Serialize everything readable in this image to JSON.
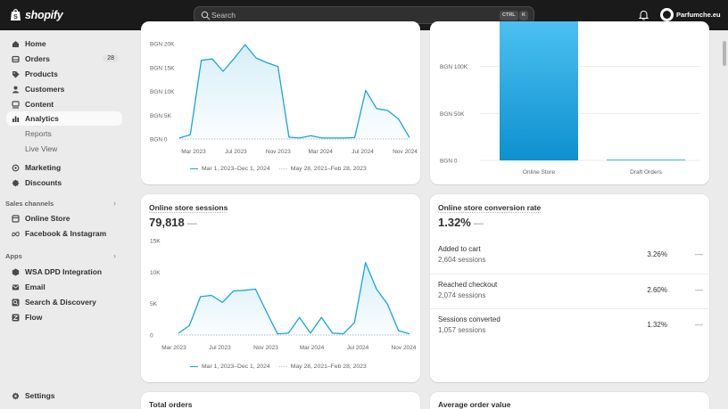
{
  "topbar": {
    "brand": "shopify",
    "search_placeholder": "Search",
    "shortcut_ctrl": "CTRL",
    "shortcut_k": "K",
    "store_name": "Parfumche.eu"
  },
  "sidebar": {
    "items": [
      {
        "label": "Home",
        "icon": "home-icon"
      },
      {
        "label": "Orders",
        "icon": "orders-icon",
        "badge": "28"
      },
      {
        "label": "Products",
        "icon": "tag-icon"
      },
      {
        "label": "Customers",
        "icon": "person-icon"
      },
      {
        "label": "Content",
        "icon": "content-icon"
      },
      {
        "label": "Analytics",
        "icon": "analytics-icon"
      },
      {
        "label": "Reports"
      },
      {
        "label": "Live View"
      },
      {
        "label": "Marketing",
        "icon": "target-icon"
      },
      {
        "label": "Discounts",
        "icon": "discount-icon"
      }
    ],
    "sales_channels_label": "Sales channels",
    "channels": [
      {
        "label": "Online Store",
        "icon": "store-icon"
      },
      {
        "label": "Facebook & Instagram",
        "icon": "meta-icon"
      }
    ],
    "apps_label": "Apps",
    "apps": [
      {
        "label": "WSA DPD Integration",
        "icon": "app-icon"
      },
      {
        "label": "Email",
        "icon": "email-icon"
      },
      {
        "label": "Search & Discovery",
        "icon": "search-app-icon"
      },
      {
        "label": "Flow",
        "icon": "flow-icon"
      }
    ],
    "settings_label": "Settings"
  },
  "sales_card": {
    "legend_current": "Mar 1, 2023–Dec 1, 2024",
    "legend_previous": "May 28, 2021–Feb 28, 2023"
  },
  "channel_card": {},
  "sessions_card": {
    "title": "Online store sessions",
    "value": "79,818",
    "trend": "—",
    "legend_current": "Mar 1, 2023–Dec 1, 2024",
    "legend_previous": "May 28, 2021–Feb 28, 2023"
  },
  "conversion_card": {
    "title": "Online store conversion rate",
    "value": "1.32%",
    "trend": "—",
    "rows": [
      {
        "name": "Added to cart",
        "sessions": "2,604 sessions",
        "rate": "3.26%",
        "trend": "—"
      },
      {
        "name": "Reached checkout",
        "sessions": "2,074 sessions",
        "rate": "2.60%",
        "trend": "—"
      },
      {
        "name": "Sessions converted",
        "sessions": "1,057 sessions",
        "rate": "1.32%",
        "trend": "—"
      }
    ]
  },
  "bottom_cards": {
    "total_orders": "Total orders",
    "aov": "Average order value"
  },
  "colors": {
    "accent": "#1ba3dc",
    "bar_top": "#4cc1f0",
    "bar_bottom": "#0e90d0",
    "topbar": "#1a1a1a"
  },
  "chart_data": [
    {
      "type": "area",
      "ylabel": "",
      "ylim": [
        0,
        20000
      ],
      "yticks": [
        "BGN 20K",
        "BGN 15K",
        "BGN 10K",
        "BGN 5K",
        "BGN 0"
      ],
      "xticks": [
        "Mar 2023",
        "Jul 2023",
        "Nov 2023",
        "Mar 2024",
        "Jul 2024",
        "Nov 2024"
      ],
      "series": [
        {
          "name": "Mar 1, 2023–Dec 1, 2024",
          "x": [
            "2023-03",
            "2023-04",
            "2023-05",
            "2023-06",
            "2023-07",
            "2023-08",
            "2023-09",
            "2023-10",
            "2023-11",
            "2023-12",
            "2024-01",
            "2024-02",
            "2024-03",
            "2024-04",
            "2024-05",
            "2024-06",
            "2024-07",
            "2024-08",
            "2024-09",
            "2024-10",
            "2024-11",
            "2024-12"
          ],
          "values": [
            200,
            900,
            16500,
            16800,
            14200,
            16900,
            19800,
            17000,
            16000,
            15200,
            400,
            200,
            700,
            200,
            200,
            200,
            300,
            10200,
            6400,
            6000,
            4200,
            300
          ]
        }
      ]
    },
    {
      "type": "bar",
      "ylim": [
        0,
        150000
      ],
      "yticks": [
        "BGN 100K",
        "BGN 50K",
        "BGN 0"
      ],
      "categories": [
        "Online Store",
        "Draft Orders"
      ],
      "values": [
        150000,
        800
      ]
    },
    {
      "type": "area",
      "ylim": [
        0,
        15000
      ],
      "yticks": [
        "15K",
        "10K",
        "5K",
        "0"
      ],
      "xticks": [
        "Mar 2023",
        "Jul 2023",
        "Nov 2023",
        "Mar 2024",
        "Jul 2024",
        "Nov 2024"
      ],
      "series": [
        {
          "name": "Mar 1, 2023–Dec 1, 2024",
          "x": [
            "2023-03",
            "2023-04",
            "2023-05",
            "2023-06",
            "2023-07",
            "2023-08",
            "2023-09",
            "2023-10",
            "2023-11",
            "2023-12",
            "2024-01",
            "2024-02",
            "2024-03",
            "2024-04",
            "2024-05",
            "2024-06",
            "2024-07",
            "2024-08",
            "2024-09",
            "2024-10",
            "2024-11",
            "2024-12"
          ],
          "values": [
            300,
            1500,
            6100,
            6300,
            5200,
            7000,
            7100,
            7300,
            3700,
            200,
            300,
            2800,
            300,
            2800,
            300,
            200,
            2000,
            11500,
            7300,
            4900,
            700,
            200
          ]
        }
      ]
    }
  ]
}
